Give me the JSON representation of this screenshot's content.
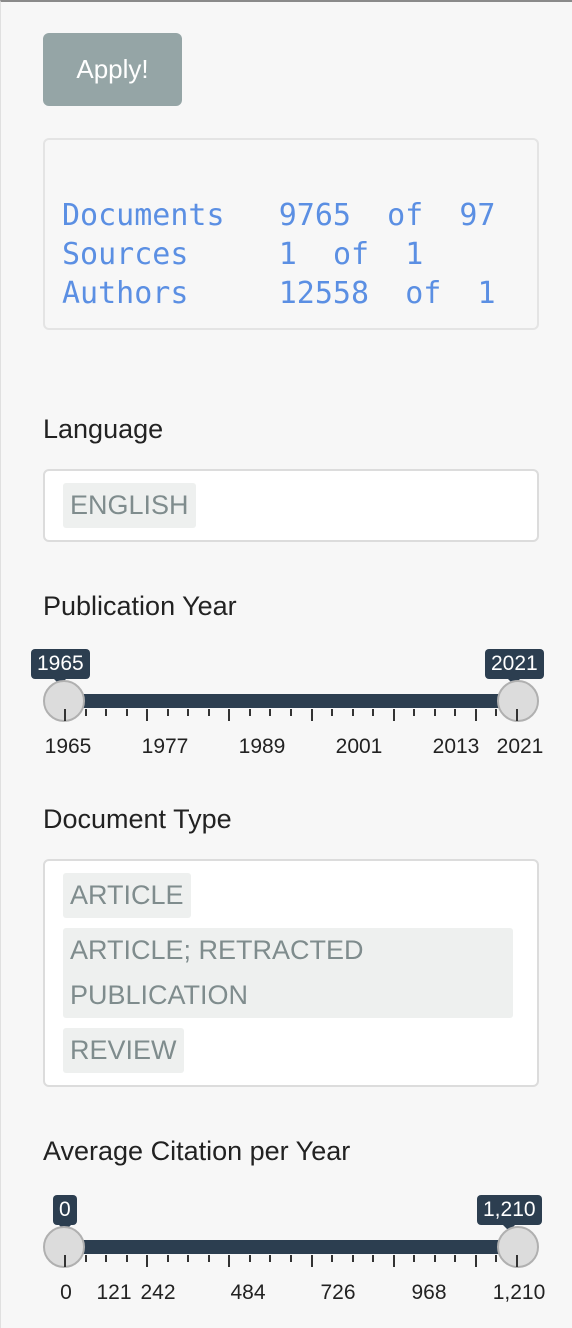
{
  "apply_button": {
    "label": "Apply!"
  },
  "stats": [
    {
      "label": "Documents",
      "value": "9765",
      "of": "of",
      "total": "97"
    },
    {
      "label": "Sources",
      "value": "1",
      "of": "of",
      "total": "1"
    },
    {
      "label": "Authors",
      "value": "12558",
      "of": "of",
      "total": "1"
    }
  ],
  "language": {
    "label": "Language",
    "selected": [
      "ENGLISH"
    ]
  },
  "publication_year": {
    "label": "Publication Year",
    "min_value": "1965",
    "max_value": "2021",
    "tick_labels": [
      "1965",
      "1977",
      "1989",
      "2001",
      "2013",
      "2021"
    ]
  },
  "document_type": {
    "label": "Document Type",
    "selected": [
      "ARTICLE",
      "ARTICLE; RETRACTED PUBLICATION",
      "REVIEW"
    ],
    "selected_display": [
      "ARTICLE",
      "ARTICLE; RETRACTED",
      "PUBLICATION",
      "REVIEW"
    ]
  },
  "avg_citation": {
    "label": "Average Citation per Year",
    "min_value": "0",
    "max_value": "1,210",
    "tick_labels": [
      "0",
      "121",
      "242",
      "484",
      "726",
      "968",
      "1,210"
    ]
  },
  "colors": {
    "apply_button": "#95a5a6",
    "stats_text": "#5b8fe3",
    "slider_track": "#2c3e50",
    "chip_bg": "#eef0ef",
    "chip_text": "#7f8c8d"
  }
}
